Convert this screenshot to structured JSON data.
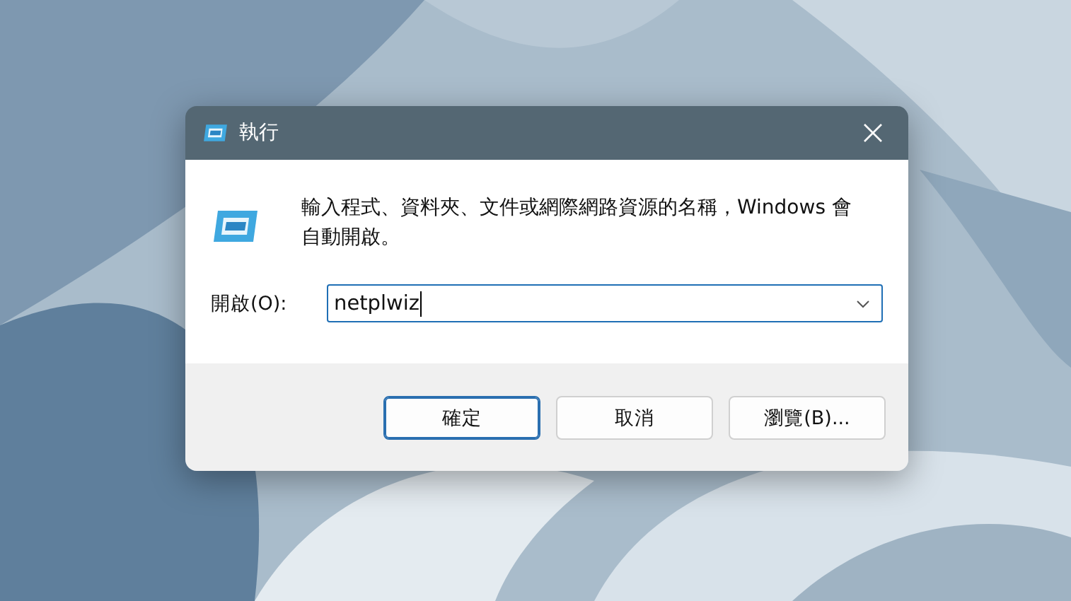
{
  "window": {
    "title": "執行"
  },
  "description": "輸入程式、資料夾、文件或網際網路資源的名稱，Windows 會自動開啟。",
  "open_field": {
    "label": "開啟(O):",
    "value": "netplwiz"
  },
  "buttons": [
    {
      "label": "確定",
      "default": true
    },
    {
      "label": "取消",
      "default": false
    },
    {
      "label": "瀏覽(B)...",
      "default": false
    }
  ]
}
